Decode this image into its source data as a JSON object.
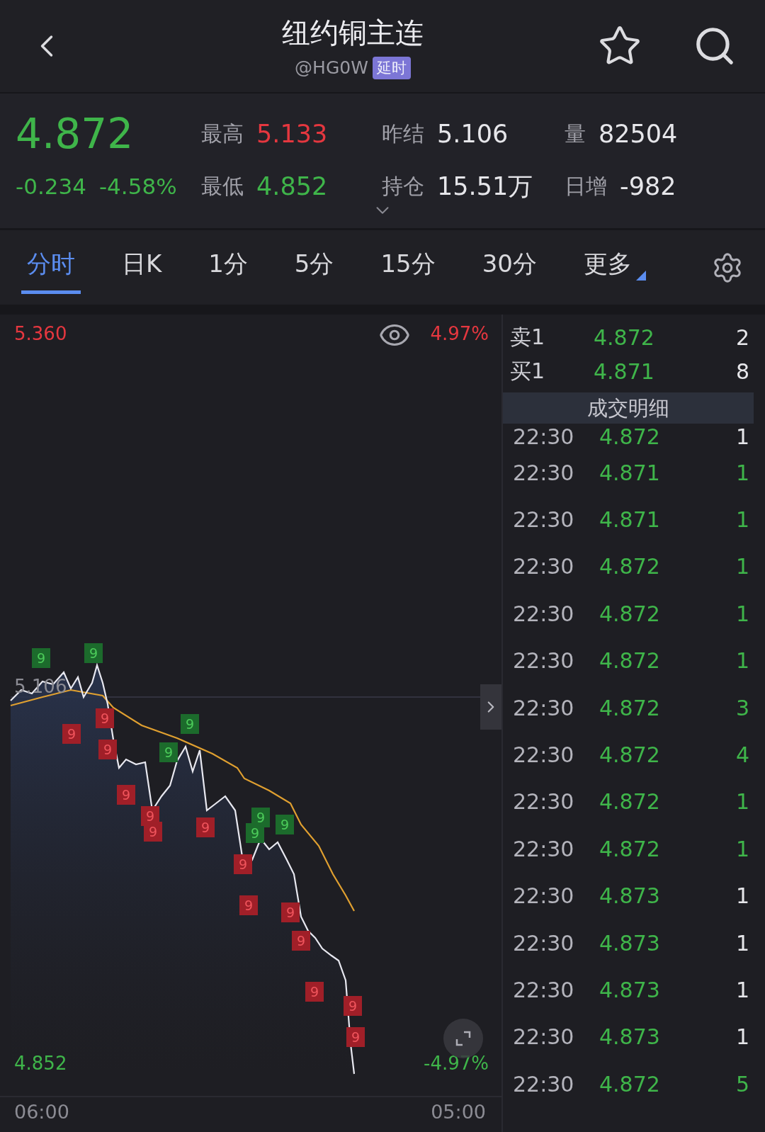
{
  "header": {
    "title": "纽约铜主连",
    "code": "@HG0W",
    "badge": "延时"
  },
  "quote": {
    "price": "4.872",
    "change": "-0.234",
    "change_pct": "-4.58%",
    "color": "#3fb54a",
    "stats": [
      {
        "label": "最高",
        "value": "5.133",
        "color": "#e5373f"
      },
      {
        "label": "昨结",
        "value": "5.106",
        "color": "#e6e6ea"
      },
      {
        "label": "量",
        "value": "82504",
        "color": "#e6e6ea"
      },
      {
        "label": "最低",
        "value": "4.852",
        "color": "#3fb54a"
      },
      {
        "label": "持仓",
        "value": "15.51万",
        "color": "#e6e6ea"
      },
      {
        "label": "日增",
        "value": "-982",
        "color": "#e6e6ea"
      }
    ]
  },
  "tabs": [
    {
      "label": "分时",
      "selected": true,
      "kind": "plain"
    },
    {
      "label": "日K",
      "selected": false,
      "kind": "plain"
    },
    {
      "label": "1分",
      "selected": false,
      "kind": "plain"
    },
    {
      "label": "5分",
      "selected": false,
      "kind": "plain"
    },
    {
      "label": "15分",
      "selected": false,
      "kind": "plain"
    },
    {
      "label": "30分",
      "selected": false,
      "kind": "plain"
    },
    {
      "label": "更多",
      "selected": false,
      "kind": "menu"
    }
  ],
  "chart": {
    "high": "5.360",
    "prev": "5.106",
    "low": "4.852",
    "top_pct": "4.97%",
    "bottom_pct": "-4.97%",
    "time_start": "06:00",
    "time_end": "05:00",
    "markers": [
      {
        "text": "9",
        "kind": "up"
      },
      {
        "text": "9",
        "kind": "up"
      },
      {
        "text": "9",
        "kind": "up"
      },
      {
        "text": "9",
        "kind": "up"
      },
      {
        "text": "9",
        "kind": "up"
      },
      {
        "text": "9",
        "kind": "up"
      },
      {
        "text": "9",
        "kind": "up"
      },
      {
        "text": "9",
        "kind": "down"
      },
      {
        "text": "9",
        "kind": "down"
      },
      {
        "text": "9",
        "kind": "down"
      },
      {
        "text": "9",
        "kind": "down"
      },
      {
        "text": "9",
        "kind": "down"
      },
      {
        "text": "9",
        "kind": "down"
      },
      {
        "text": "9",
        "kind": "down"
      },
      {
        "text": "9",
        "kind": "down"
      },
      {
        "text": "9",
        "kind": "down"
      },
      {
        "text": "9",
        "kind": "down"
      },
      {
        "text": "9",
        "kind": "down"
      },
      {
        "text": "9",
        "kind": "down"
      },
      {
        "text": "9",
        "kind": "down"
      },
      {
        "text": "9",
        "kind": "down"
      }
    ]
  },
  "order_book": [
    {
      "side": "卖1",
      "price": "4.872",
      "volume": "2"
    },
    {
      "side": "买1",
      "price": "4.871",
      "volume": "8"
    }
  ],
  "trades_title": "成交明细",
  "trades": [
    {
      "time": "22:30",
      "price": "4.872",
      "volume": "1",
      "color": "#e6e6ea"
    },
    {
      "time": "22:30",
      "price": "4.871",
      "volume": "1",
      "color": "#3fb54a"
    },
    {
      "time": "22:30",
      "price": "4.871",
      "volume": "1",
      "color": "#3fb54a"
    },
    {
      "time": "22:30",
      "price": "4.872",
      "volume": "1",
      "color": "#3fb54a"
    },
    {
      "time": "22:30",
      "price": "4.872",
      "volume": "1",
      "color": "#3fb54a"
    },
    {
      "time": "22:30",
      "price": "4.872",
      "volume": "1",
      "color": "#3fb54a"
    },
    {
      "time": "22:30",
      "price": "4.872",
      "volume": "3",
      "color": "#3fb54a"
    },
    {
      "time": "22:30",
      "price": "4.872",
      "volume": "4",
      "color": "#3fb54a"
    },
    {
      "time": "22:30",
      "price": "4.872",
      "volume": "1",
      "color": "#3fb54a"
    },
    {
      "time": "22:30",
      "price": "4.872",
      "volume": "1",
      "color": "#3fb54a"
    },
    {
      "time": "22:30",
      "price": "4.873",
      "volume": "1",
      "color": "#e6e6ea"
    },
    {
      "time": "22:30",
      "price": "4.873",
      "volume": "1",
      "color": "#e6e6ea"
    },
    {
      "time": "22:30",
      "price": "4.873",
      "volume": "1",
      "color": "#e6e6ea"
    },
    {
      "time": "22:30",
      "price": "4.873",
      "volume": "1",
      "color": "#e6e6ea"
    },
    {
      "time": "22:30",
      "price": "4.872",
      "volume": "5",
      "color": "#3fb54a"
    }
  ]
}
